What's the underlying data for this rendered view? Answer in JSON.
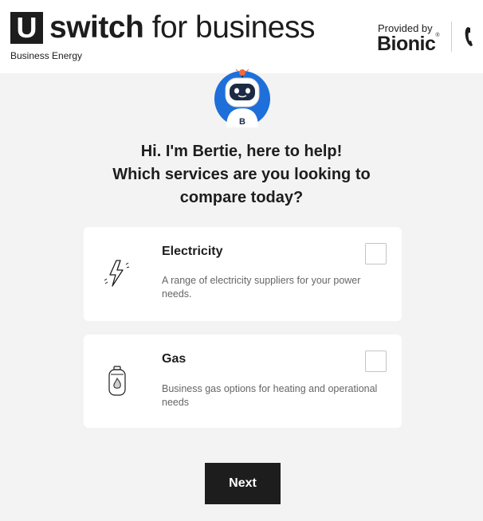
{
  "header": {
    "logo_letter": "U",
    "logo_bold": "switch",
    "logo_rest": " for business",
    "subtitle": "Business Energy",
    "provided_by": "Provided by",
    "partner": "Bionic",
    "partner_mark": "®",
    "phone_icon": "phone-icon"
  },
  "assistant": {
    "avatar_icon": "robot-avatar-icon",
    "avatar_letter": "B",
    "question_line1": "Hi. I'm Bertie, here to help!",
    "question_line2": "Which services are you looking to",
    "question_line3": "compare today?"
  },
  "services": [
    {
      "title": "Electricity",
      "description": "A range of electricity suppliers for your power needs.",
      "icon": "lightning-bolt-icon",
      "checked": false
    },
    {
      "title": "Gas",
      "description": "Business gas options for heating and operational needs",
      "icon": "gas-bottle-icon",
      "checked": false
    }
  ],
  "actions": {
    "next_label": "Next"
  },
  "colors": {
    "brand_dark": "#1d1d1d",
    "background": "#f3f3f3",
    "avatar_blue": "#1e6fd9",
    "antenna_orange": "#f06a3c"
  }
}
